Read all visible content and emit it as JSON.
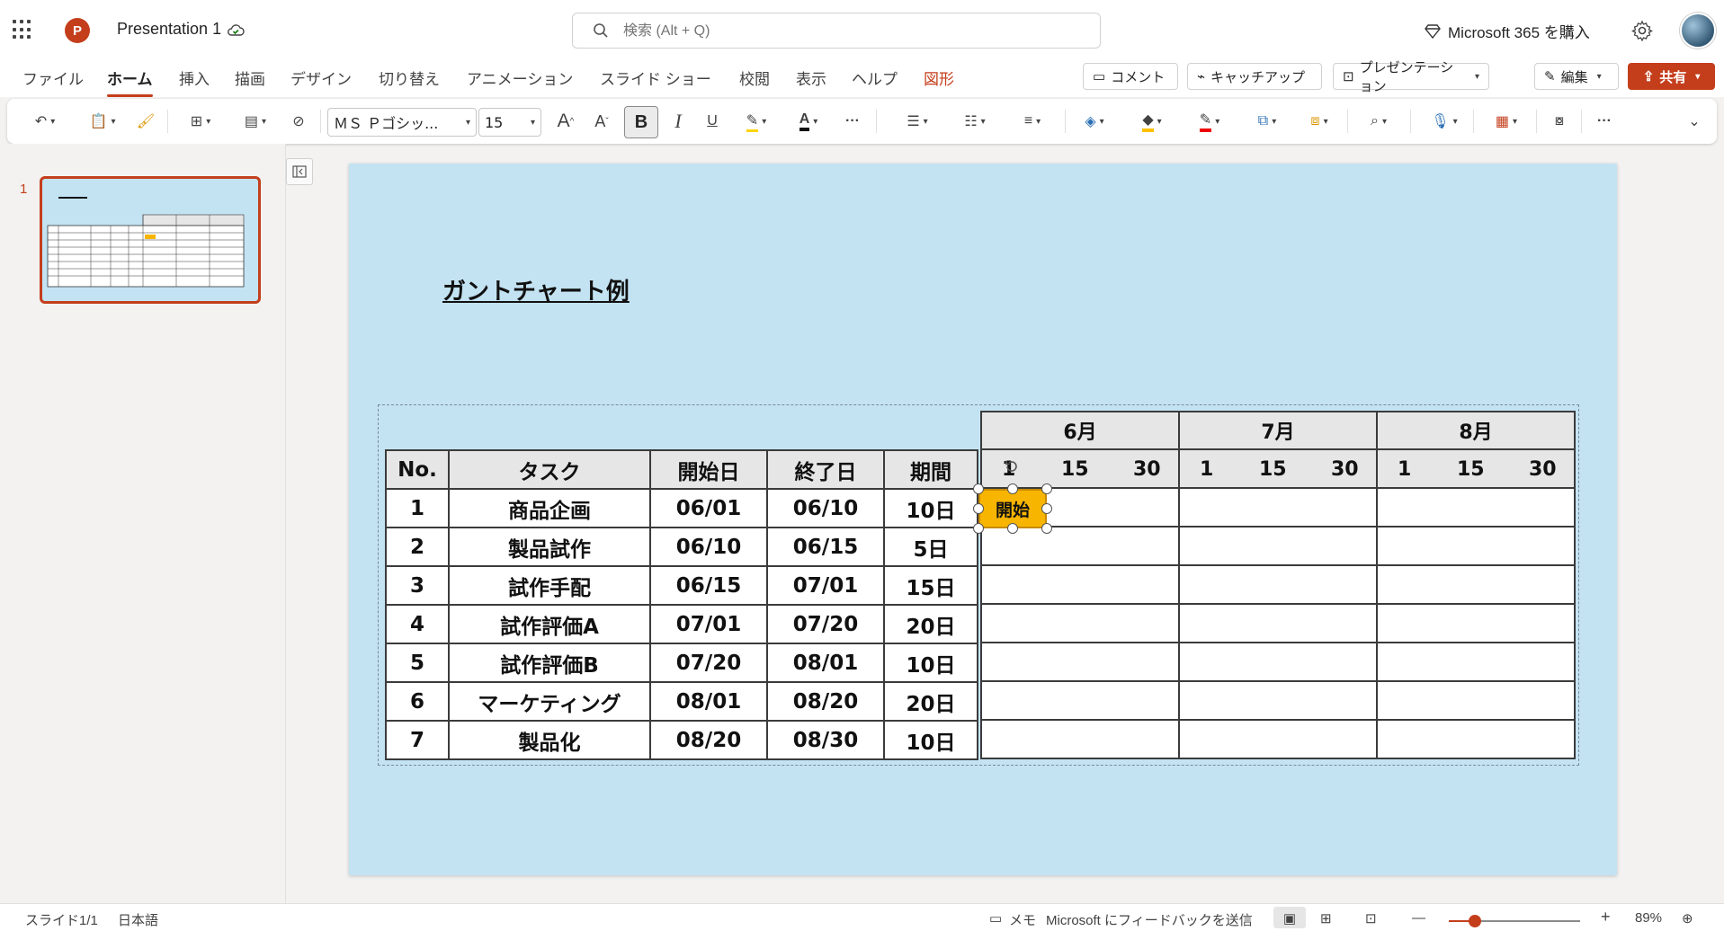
{
  "app": {
    "title": "Presentation 1",
    "search_placeholder": "検索 (Alt + Q)",
    "buy_label": "Microsoft 365 を購入",
    "logo": "P"
  },
  "tabs": [
    {
      "label": "ファイル"
    },
    {
      "label": "ホーム"
    },
    {
      "label": "挿入"
    },
    {
      "label": "描画"
    },
    {
      "label": "デザイン"
    },
    {
      "label": "切り替え"
    },
    {
      "label": "アニメーション"
    },
    {
      "label": "スライド ショー"
    },
    {
      "label": "校閲"
    },
    {
      "label": "表示"
    },
    {
      "label": "ヘルプ"
    },
    {
      "label": "図形"
    }
  ],
  "tab_actions": {
    "comment": "コメント",
    "catchup": "キャッチアップ",
    "present": "プレゼンテーション",
    "edit": "編集",
    "share": "共有"
  },
  "ribbon": {
    "font_name": "ＭＳ Ｐゴシッ...",
    "font_size": "15",
    "bold": "B",
    "italic": "I",
    "underline": "U",
    "grow_font": "A",
    "shrink_font": "A",
    "font_color": "A",
    "more": "···"
  },
  "thumbnail": {
    "number": "1"
  },
  "slide": {
    "title": "ガントチャート例",
    "table": {
      "headers": [
        "No.",
        "タスク",
        "開始日",
        "終了日",
        "期間"
      ],
      "rows": [
        [
          "1",
          "商品企画",
          "06/01",
          "06/10",
          "10日"
        ],
        [
          "2",
          "製品試作",
          "06/10",
          "06/15",
          "5日"
        ],
        [
          "3",
          "試作手配",
          "06/15",
          "07/01",
          "15日"
        ],
        [
          "4",
          "試作評価A",
          "07/01",
          "07/20",
          "20日"
        ],
        [
          "5",
          "試作評価B",
          "07/20",
          "08/01",
          "10日"
        ],
        [
          "6",
          "マーケティング",
          "08/01",
          "08/20",
          "20日"
        ],
        [
          "7",
          "製品化",
          "08/20",
          "08/30",
          "10日"
        ]
      ]
    },
    "gantt": {
      "months": [
        "6月",
        "7月",
        "8月"
      ],
      "days": [
        "1",
        "15",
        "30"
      ]
    },
    "start_shape": "開始"
  },
  "status": {
    "slide": "スライド1/1",
    "language": "日本語",
    "notes": "メモ",
    "feedback": "Microsoft にフィードバックを送信",
    "zoom": "89%",
    "zoom_level": 0.2
  },
  "colors": {
    "accent": "#c43e1c",
    "slide_bg": "#c3e3f3",
    "shape_fill": "#f7b500"
  }
}
